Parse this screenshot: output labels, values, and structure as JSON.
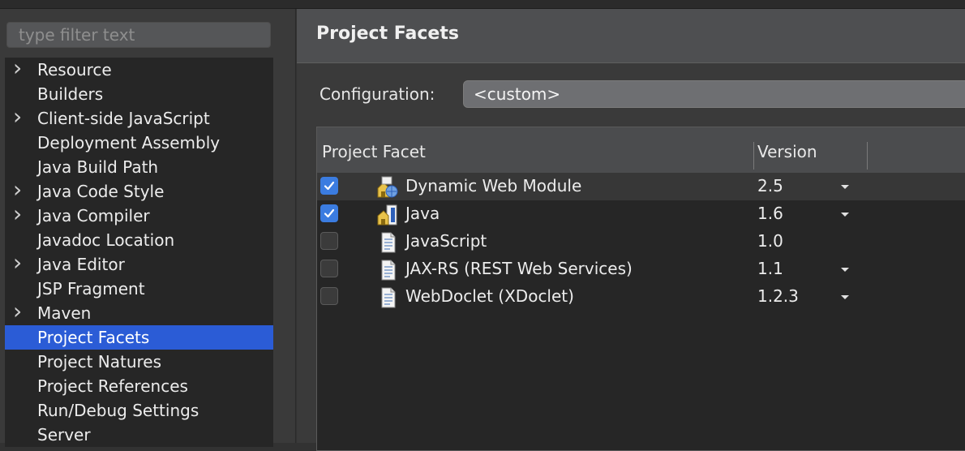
{
  "filter": {
    "placeholder": "type filter text"
  },
  "tree": {
    "items": [
      {
        "label": "Resource",
        "expandable": true,
        "selected": false
      },
      {
        "label": "Builders",
        "expandable": false,
        "selected": false
      },
      {
        "label": "Client-side JavaScript",
        "expandable": true,
        "selected": false
      },
      {
        "label": "Deployment Assembly",
        "expandable": false,
        "selected": false
      },
      {
        "label": "Java Build Path",
        "expandable": false,
        "selected": false
      },
      {
        "label": "Java Code Style",
        "expandable": true,
        "selected": false
      },
      {
        "label": "Java Compiler",
        "expandable": true,
        "selected": false
      },
      {
        "label": "Javadoc Location",
        "expandable": false,
        "selected": false
      },
      {
        "label": "Java Editor",
        "expandable": true,
        "selected": false
      },
      {
        "label": "JSP Fragment",
        "expandable": false,
        "selected": false
      },
      {
        "label": "Maven",
        "expandable": true,
        "selected": false
      },
      {
        "label": "Project Facets",
        "expandable": false,
        "selected": true
      },
      {
        "label": "Project Natures",
        "expandable": false,
        "selected": false
      },
      {
        "label": "Project References",
        "expandable": false,
        "selected": false
      },
      {
        "label": "Run/Debug Settings",
        "expandable": false,
        "selected": false
      },
      {
        "label": "Server",
        "expandable": false,
        "selected": false
      }
    ]
  },
  "page": {
    "title": "Project Facets"
  },
  "config": {
    "label": "Configuration:",
    "value": "<custom>"
  },
  "table": {
    "col_facet": "Project Facet",
    "col_version": "Version",
    "rows": [
      {
        "name": "Dynamic Web Module",
        "version": "2.5",
        "checked": true,
        "has_dropdown": true,
        "highlighted": true,
        "icon": "web-module-icon"
      },
      {
        "name": "Java",
        "version": "1.6",
        "checked": true,
        "has_dropdown": true,
        "highlighted": false,
        "icon": "java-facet-icon"
      },
      {
        "name": "JavaScript",
        "version": "1.0",
        "checked": false,
        "has_dropdown": false,
        "highlighted": false,
        "icon": "document-icon"
      },
      {
        "name": "JAX-RS (REST Web Services)",
        "version": "1.1",
        "checked": false,
        "has_dropdown": true,
        "highlighted": false,
        "icon": "document-icon"
      },
      {
        "name": "WebDoclet (XDoclet)",
        "version": "1.2.3",
        "checked": false,
        "has_dropdown": true,
        "highlighted": false,
        "icon": "document-icon"
      }
    ]
  },
  "colors": {
    "selection": "#2b5cd6",
    "checkbox_checked": "#3b7ce0"
  }
}
